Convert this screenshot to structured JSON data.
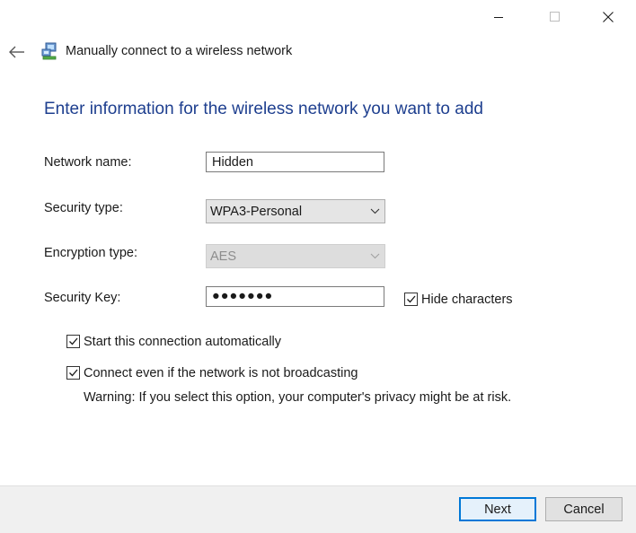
{
  "window": {
    "title": "Manually connect to a wireless network",
    "controls": {
      "minimize": "minimize-icon",
      "maximize": "maximize-icon",
      "close": "close-icon"
    }
  },
  "heading": "Enter information for the wireless network you want to add",
  "form": {
    "network_name": {
      "label": "Network name:",
      "value": "Hidden"
    },
    "security_type": {
      "label": "Security type:",
      "value": "WPA3-Personal"
    },
    "encryption_type": {
      "label": "Encryption type:",
      "value": "AES",
      "enabled": false
    },
    "security_key": {
      "label": "Security Key:",
      "value": "●●●●●●●",
      "masked": true
    },
    "hide_characters": {
      "label": "Hide characters",
      "checked": true
    }
  },
  "options": {
    "start_automatically": {
      "label": "Start this connection automatically",
      "checked": true
    },
    "connect_not_broadcasting": {
      "label": "Connect even if the network is not broadcasting",
      "checked": true
    },
    "warning": "Warning: If you select this option, your computer's privacy might be at risk."
  },
  "buttons": {
    "next": "Next",
    "cancel": "Cancel"
  },
  "colors": {
    "heading": "#1e3f8f",
    "default_button_border": "#0078d7",
    "footer": "#f0f0f0"
  }
}
